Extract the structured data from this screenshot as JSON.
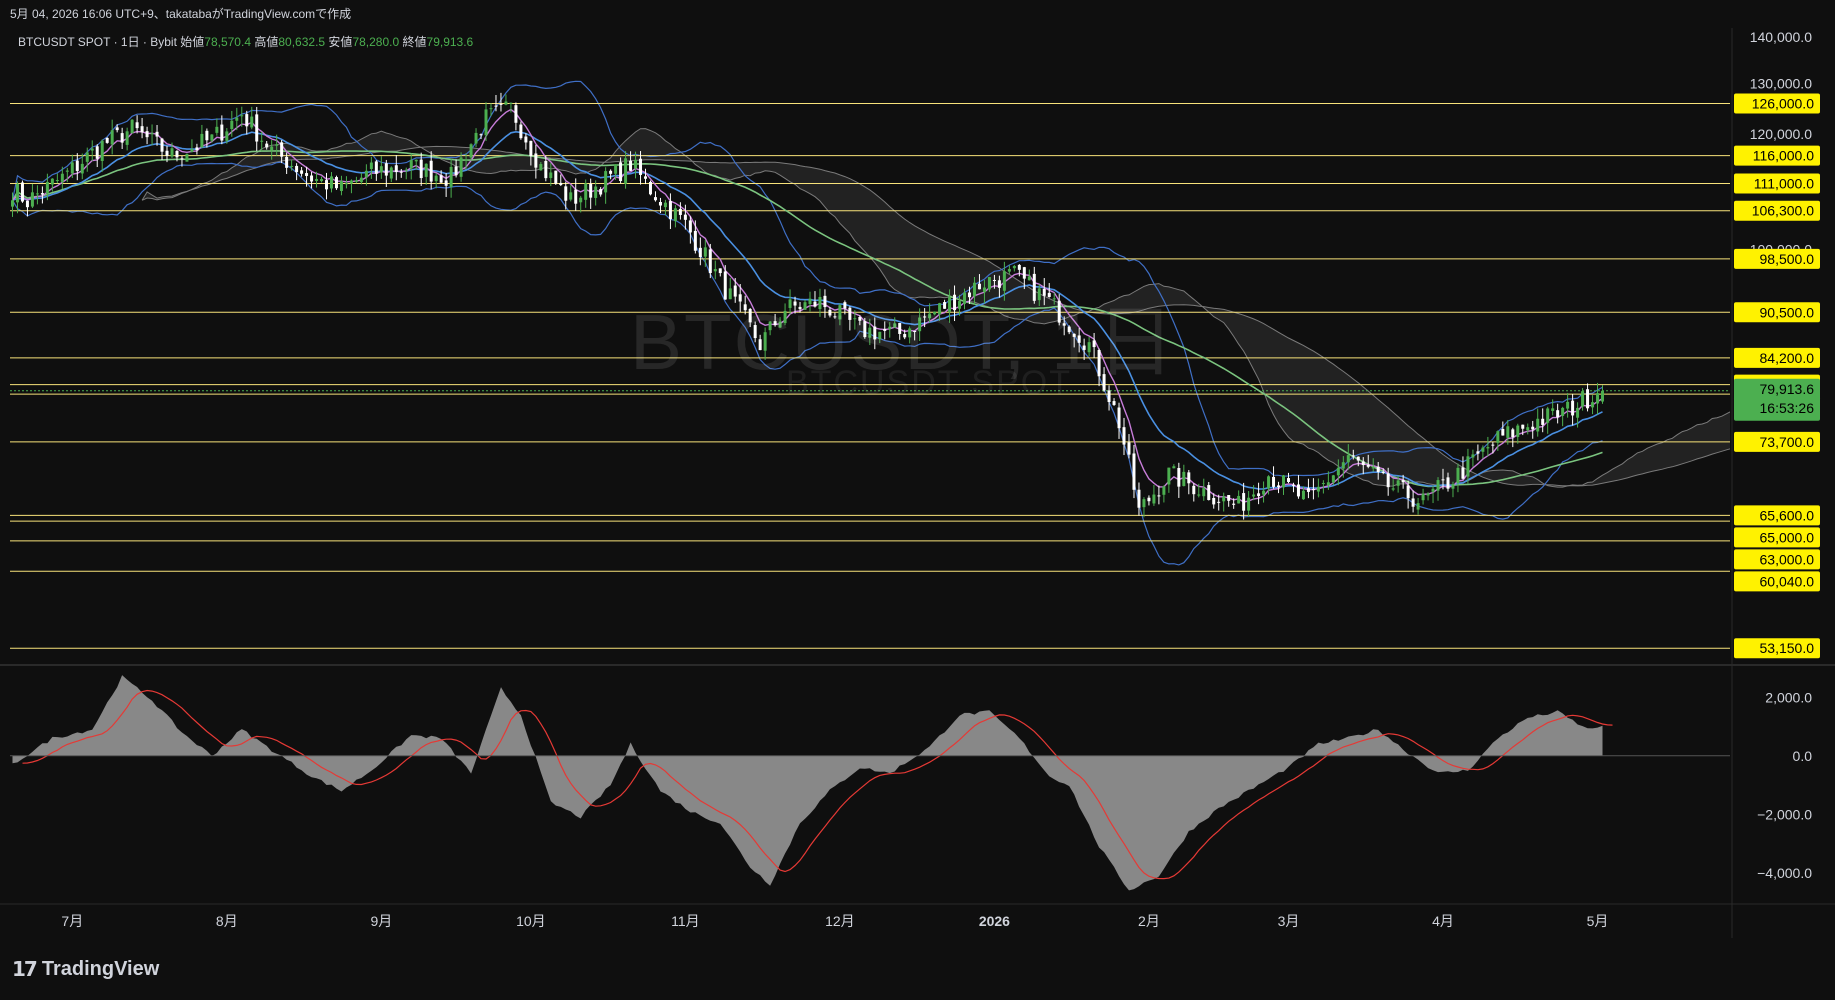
{
  "header": {
    "caption": "5月 04, 2026 16:06 UTC+9、takatabaがTradingView.comで作成"
  },
  "legend": {
    "symbol": "BTCUSDT SPOT · 1日 · Bybit",
    "open_label": "始値",
    "open": "78,570.4",
    "high_label": "高値",
    "high": "80,632.5",
    "low_label": "安値",
    "low": "78,280.0",
    "close_label": "終値",
    "close": "79,913.6"
  },
  "watermark": {
    "title": "BTCUSDT, 1日",
    "subtitle": "BTCUSDT SPOT"
  },
  "footer": {
    "brand": "TradingView"
  },
  "colors": {
    "background": "#0f0f0f",
    "up": "#4caf50",
    "down": "#ffffff",
    "level_line": "#f7e27a",
    "level_badge": "#fff200",
    "price_badge": "#4caf50",
    "ema_short": "#c77dd9",
    "ema_mid": "#4a90e2",
    "sma_long": "#7bc47f",
    "bollinger": "#3f6fc6",
    "cloud": "#7a7a7a",
    "macd_signal": "#e53935",
    "macd_hist": "#9e9e9e"
  },
  "chart_data": [
    {
      "type": "candlestick",
      "title": "BTCUSDT SPOT · 1日 · Bybit",
      "x_ticks": [
        "7月",
        "8月",
        "9月",
        "10月",
        "11月",
        "12月",
        "2026",
        "2月",
        "3月",
        "4月",
        "5月"
      ],
      "y_ticks": [
        "140,000.0",
        "130,000.0",
        "120,000.0",
        "100,000.0"
      ],
      "y_axis": "log",
      "ylim": [
        52000,
        142000
      ],
      "anchors": [
        [
          0,
          110000
        ],
        [
          3,
          108000
        ],
        [
          10,
          112000
        ],
        [
          18,
          118000
        ],
        [
          24,
          121000
        ],
        [
          32,
          116000
        ],
        [
          40,
          119000
        ],
        [
          46,
          124000
        ],
        [
          52,
          117000
        ],
        [
          60,
          112000
        ],
        [
          66,
          110000
        ],
        [
          72,
          113000
        ],
        [
          80,
          114000
        ],
        [
          88,
          112000
        ],
        [
          95,
          123000
        ],
        [
          100,
          125000
        ],
        [
          106,
          114000
        ],
        [
          112,
          108000
        ],
        [
          118,
          111000
        ],
        [
          124,
          114500
        ],
        [
          128,
          110000
        ],
        [
          135,
          104000
        ],
        [
          142,
          95000
        ],
        [
          150,
          86000
        ],
        [
          155,
          91000
        ],
        [
          162,
          92000
        ],
        [
          170,
          88000
        ],
        [
          178,
          87500
        ],
        [
          186,
          91000
        ],
        [
          195,
          95000
        ],
        [
          201,
          96000
        ],
        [
          208,
          92000
        ],
        [
          216,
          86000
        ],
        [
          222,
          76000
        ],
        [
          226,
          66000
        ],
        [
          232,
          70000
        ],
        [
          240,
          68000
        ],
        [
          246,
          66500
        ],
        [
          252,
          70000
        ],
        [
          260,
          67000
        ],
        [
          268,
          72000
        ],
        [
          275,
          69000
        ],
        [
          283,
          67000
        ],
        [
          290,
          70000
        ],
        [
          298,
          74000
        ],
        [
          305,
          76000
        ],
        [
          312,
          77500
        ],
        [
          318,
          79913.6
        ]
      ],
      "last_candle": {
        "open": 78570.4,
        "high": 80632.5,
        "low": 78280.0,
        "close": 79913.6
      },
      "horizontal_levels": [
        {
          "label": "126,000.0",
          "value": 126000
        },
        {
          "label": "116,000.0",
          "value": 116000
        },
        {
          "label": "111,000.0",
          "value": 111000
        },
        {
          "label": "106,300.0",
          "value": 106300
        },
        {
          "label": "98,500.0",
          "value": 98500
        },
        {
          "label": "90,500.0",
          "value": 90500
        },
        {
          "label": "84,200.0",
          "value": 84200
        },
        {
          "label": "80,700.0",
          "value": 80700
        },
        {
          "label": "79,500.0",
          "value": 79500
        },
        {
          "label": "73,700.0",
          "value": 73700
        },
        {
          "label": "65,600.0",
          "value": 65600
        },
        {
          "label": "65,000.0",
          "value": 65000
        },
        {
          "label": "63,000.0",
          "value": 63000
        },
        {
          "label": "60,040.0",
          "value": 60040
        },
        {
          "label": "53,150.0",
          "value": 53150
        }
      ],
      "current_price": {
        "label": "79,913.6",
        "value": 79913.6,
        "countdown": "16:53:26"
      }
    },
    {
      "type": "area",
      "title": "",
      "y_ticks": [
        "2,000.0",
        "0.0",
        "−2,000.0",
        "−4,000.0"
      ],
      "ylim": [
        -5000,
        3000
      ],
      "histogram_anchors": [
        [
          0,
          -300
        ],
        [
          8,
          600
        ],
        [
          16,
          900
        ],
        [
          22,
          2700
        ],
        [
          28,
          1900
        ],
        [
          34,
          800
        ],
        [
          40,
          0
        ],
        [
          46,
          900
        ],
        [
          52,
          200
        ],
        [
          60,
          -700
        ],
        [
          66,
          -1200
        ],
        [
          72,
          -500
        ],
        [
          80,
          700
        ],
        [
          86,
          600
        ],
        [
          92,
          -600
        ],
        [
          98,
          2300
        ],
        [
          102,
          1400
        ],
        [
          108,
          -1600
        ],
        [
          114,
          -2100
        ],
        [
          120,
          -1000
        ],
        [
          124,
          400
        ],
        [
          130,
          -1200
        ],
        [
          136,
          -1900
        ],
        [
          142,
          -2300
        ],
        [
          148,
          -3800
        ],
        [
          152,
          -4400
        ],
        [
          158,
          -2300
        ],
        [
          164,
          -1200
        ],
        [
          170,
          -400
        ],
        [
          176,
          -600
        ],
        [
          184,
          300
        ],
        [
          190,
          1400
        ],
        [
          196,
          1500
        ],
        [
          202,
          600
        ],
        [
          208,
          -700
        ],
        [
          212,
          -1000
        ],
        [
          218,
          -3100
        ],
        [
          224,
          -4600
        ],
        [
          230,
          -4100
        ],
        [
          236,
          -2600
        ],
        [
          242,
          -1800
        ],
        [
          250,
          -1000
        ],
        [
          256,
          -400
        ],
        [
          262,
          400
        ],
        [
          268,
          600
        ],
        [
          274,
          900
        ],
        [
          280,
          100
        ],
        [
          286,
          -600
        ],
        [
          292,
          -500
        ],
        [
          298,
          600
        ],
        [
          304,
          1300
        ],
        [
          310,
          1500
        ],
        [
          316,
          900
        ],
        [
          318,
          1000
        ]
      ]
    }
  ]
}
